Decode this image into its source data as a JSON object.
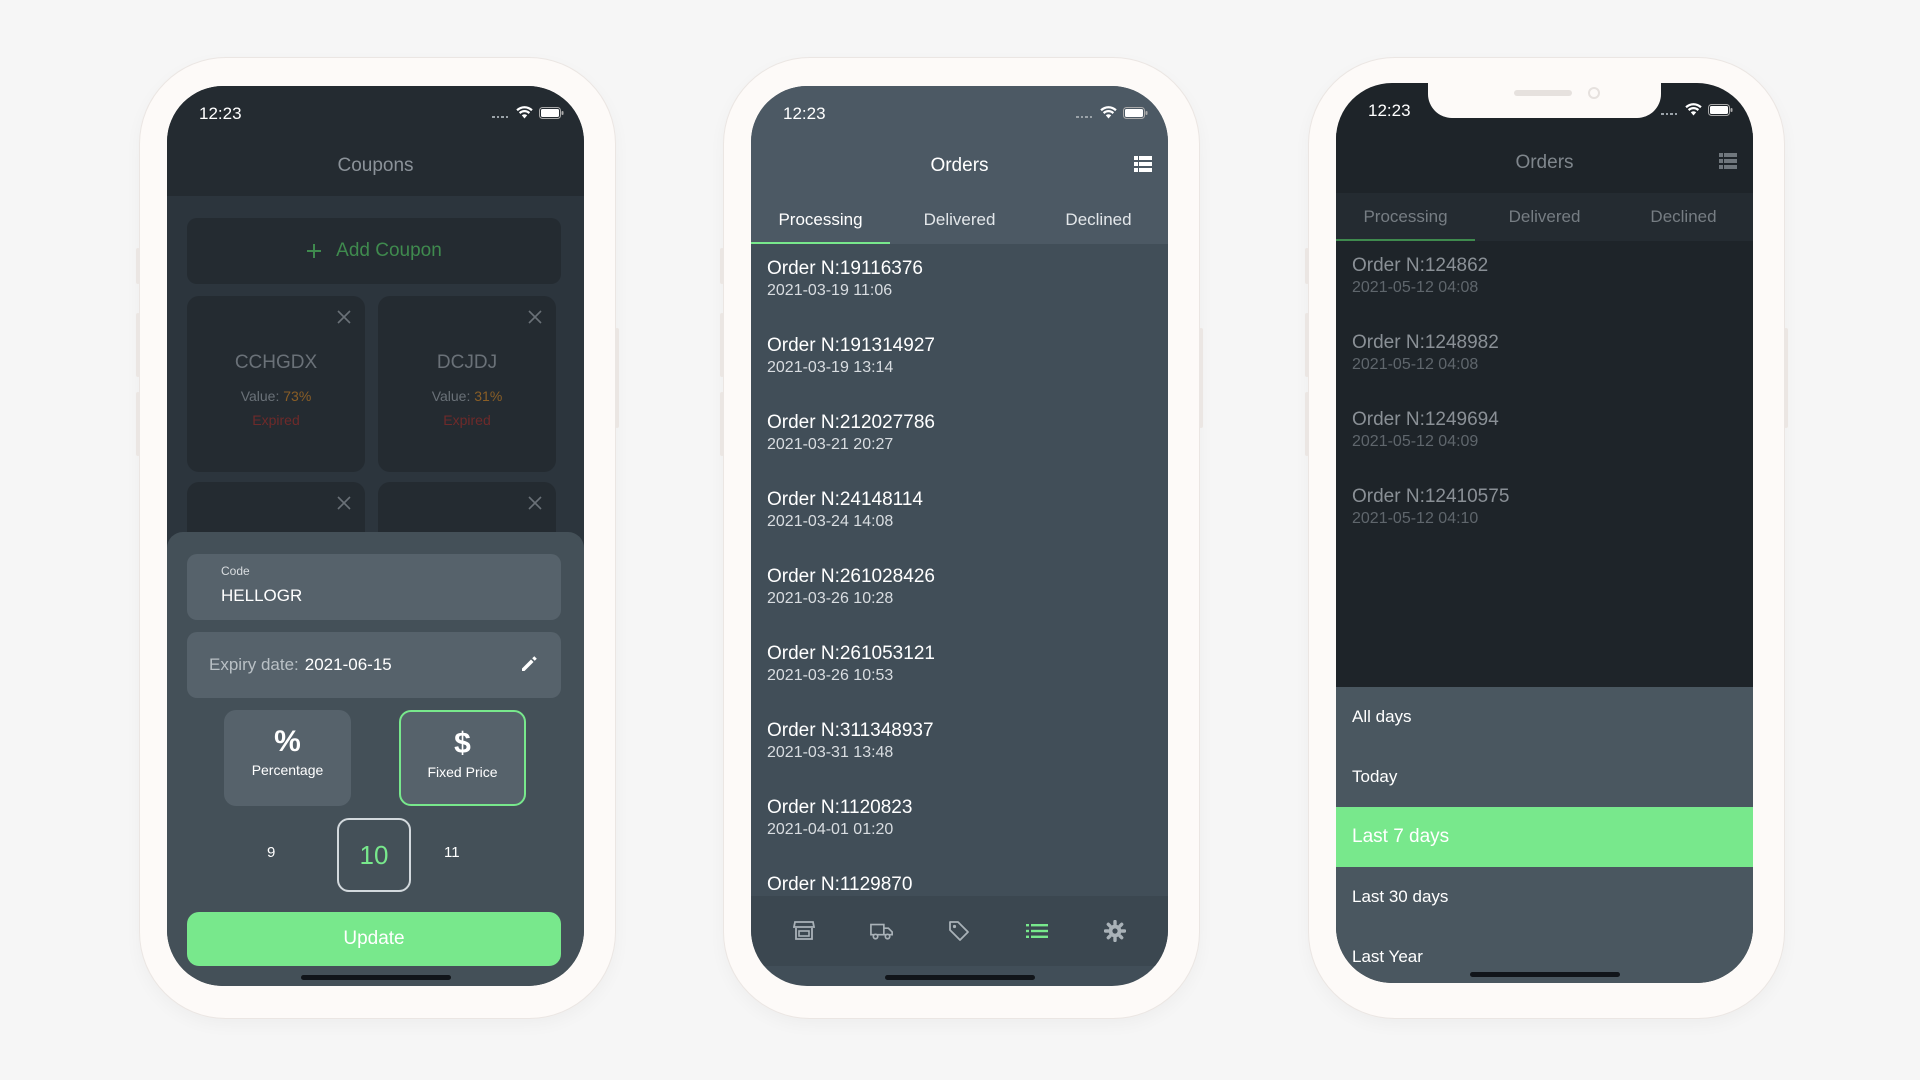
{
  "status": {
    "time": "12:23"
  },
  "phone1": {
    "title": "Coupons",
    "add_coupon_label": "Add Coupon",
    "coupons": [
      {
        "code": "CCHGDX",
        "value_label": "Value:",
        "value": "73%",
        "status": "Expired"
      },
      {
        "code": "DCJDJ",
        "value_label": "Value:",
        "value": "31%",
        "status": "Expired"
      }
    ],
    "form": {
      "code_label": "Code",
      "code_value": "HELLOGR",
      "expiry_label": "Expiry date:",
      "expiry_value": "2021-06-15",
      "type_percentage_label": "Percentage",
      "type_fixed_label": "Fixed Price",
      "stepper_prev": "9",
      "stepper_current": "10",
      "stepper_next": "11",
      "update_label": "Update"
    }
  },
  "phone2": {
    "title": "Orders",
    "tabs": [
      "Processing",
      "Delivered",
      "Declined"
    ],
    "orders": [
      {
        "number": "Order N:19116376",
        "date": "2021-03-19 11:06"
      },
      {
        "number": "Order N:191314927",
        "date": "2021-03-19 13:14"
      },
      {
        "number": "Order N:212027786",
        "date": "2021-03-21 20:27"
      },
      {
        "number": "Order N:24148114",
        "date": "2021-03-24 14:08"
      },
      {
        "number": "Order N:261028426",
        "date": "2021-03-26 10:28"
      },
      {
        "number": "Order N:261053121",
        "date": "2021-03-26 10:53"
      },
      {
        "number": "Order N:311348937",
        "date": "2021-03-31 13:48"
      },
      {
        "number": "Order N:1120823",
        "date": "2021-04-01 01:20"
      },
      {
        "number": "Order N:1129870",
        "date": ""
      }
    ]
  },
  "phone3": {
    "title": "Orders",
    "tabs": [
      "Processing",
      "Delivered",
      "Declined"
    ],
    "orders": [
      {
        "number": "Order N:124862",
        "date": "2021-05-12 04:08"
      },
      {
        "number": "Order N:1248982",
        "date": "2021-05-12 04:08"
      },
      {
        "number": "Order N:1249694",
        "date": "2021-05-12 04:09"
      },
      {
        "number": "Order N:12410575",
        "date": "2021-05-12 04:10"
      }
    ],
    "filter_options": [
      "All days",
      "Today",
      "Last 7 days",
      "Last 30 days",
      "Last Year"
    ],
    "filter_selected": "Last 7 days"
  },
  "colors": {
    "accent": "#78e88c",
    "warning": "#8a5e26",
    "danger": "#6e2a2a"
  }
}
